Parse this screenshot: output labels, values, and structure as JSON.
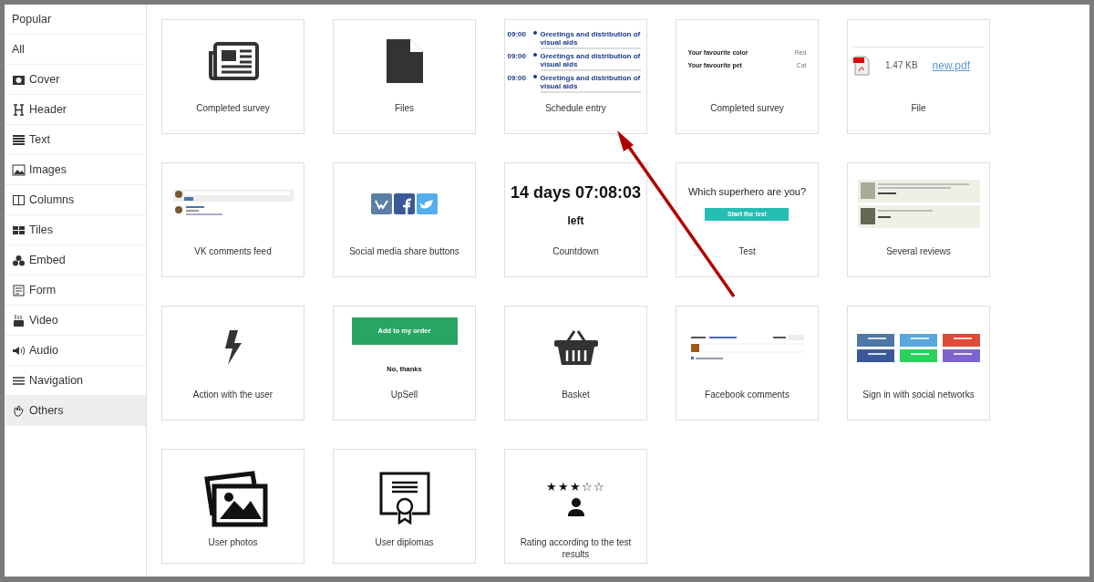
{
  "sidebar": {
    "items": [
      {
        "label": "Popular",
        "selected": false
      },
      {
        "label": "All",
        "selected": false
      },
      {
        "label": "Cover",
        "selected": false
      },
      {
        "label": "Header",
        "selected": false
      },
      {
        "label": "Text",
        "selected": false
      },
      {
        "label": "Images",
        "selected": false
      },
      {
        "label": "Columns",
        "selected": false
      },
      {
        "label": "Tiles",
        "selected": false
      },
      {
        "label": "Embed",
        "selected": false
      },
      {
        "label": "Form",
        "selected": false
      },
      {
        "label": "Video",
        "selected": false
      },
      {
        "label": "Audio",
        "selected": false
      },
      {
        "label": "Navigation",
        "selected": false
      },
      {
        "label": "Others",
        "selected": true
      }
    ]
  },
  "tiles": [
    {
      "kind": "newspaper",
      "label": "Completed survey"
    },
    {
      "kind": "file",
      "label": "Files"
    },
    {
      "kind": "schedule",
      "label": "Schedule entry",
      "entries": [
        {
          "time": "09:00",
          "title": "Greetings and distribution of visual aids"
        },
        {
          "time": "09:00",
          "title": "Greetings and distribution of visual aids"
        },
        {
          "time": "09:00",
          "title": "Greetings and distribution of visual aids"
        }
      ]
    },
    {
      "kind": "survey",
      "label": "Completed survey",
      "rows": [
        {
          "question": "Your favourite color",
          "answer": "Red"
        },
        {
          "question": "Your favourite pet",
          "answer": "Cat"
        }
      ]
    },
    {
      "kind": "pdf",
      "label": "File",
      "size": "1.47 KB",
      "filename": "new.pdf"
    },
    {
      "kind": "vkfeed",
      "label": "VK comments feed"
    },
    {
      "kind": "share",
      "label": "Social media share buttons"
    },
    {
      "kind": "countdown",
      "label": "Countdown",
      "time": "14 days 07:08:03",
      "suffix": "left"
    },
    {
      "kind": "test",
      "label": "Test",
      "question": "Which superhero are you?",
      "button": "Start the test"
    },
    {
      "kind": "reviews",
      "label": "Several reviews"
    },
    {
      "kind": "action",
      "label": "Action with the user"
    },
    {
      "kind": "upsell",
      "label": "UpSell",
      "button": "Add to my order",
      "decline": "No, thanks"
    },
    {
      "kind": "basket",
      "label": "Basket"
    },
    {
      "kind": "fbcomments",
      "label": "Facebook comments"
    },
    {
      "kind": "signin",
      "label": "Sign in with social networks"
    },
    {
      "kind": "photos",
      "label": "User photos"
    },
    {
      "kind": "diploma",
      "label": "User diplomas"
    },
    {
      "kind": "rating",
      "label": "Rating according to the test results",
      "stars": 3
    }
  ]
}
